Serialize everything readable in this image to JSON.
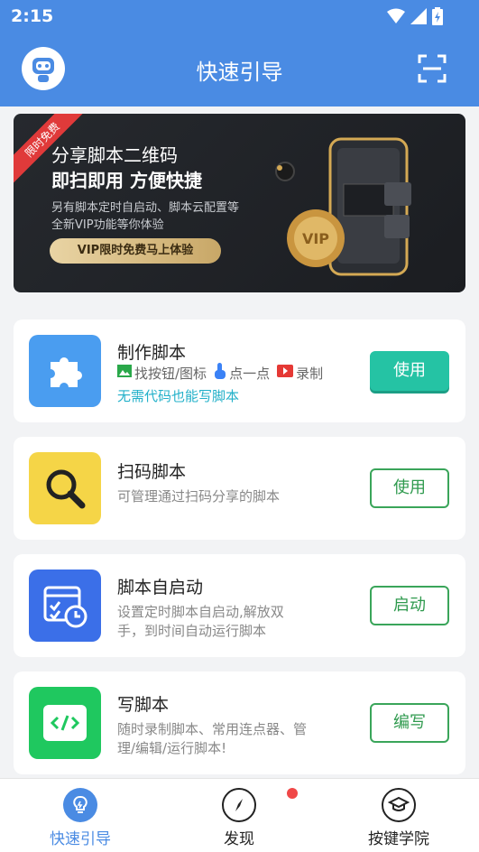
{
  "status_bar": {
    "time": "2:15"
  },
  "header": {
    "title": "快速引导"
  },
  "banner": {
    "ribbon": "限时免费",
    "title_line1": "分享脚本二维码",
    "title_line2": "即扫即用 方便快捷",
    "desc_line1": "另有脚本定时自启动、脚本云配置等",
    "desc_line2": "全新VIP功能等你体验",
    "button": "VIP限时免费马上体验",
    "coin_text": "VIP"
  },
  "cards": [
    {
      "title": "制作脚本",
      "features": [
        "找按钮/图标",
        "点一点",
        "录制"
      ],
      "hint": "无需代码也能写脚本",
      "button": "使用",
      "color": "#4a9df0"
    },
    {
      "title": "扫码脚本",
      "desc": "可管理通过扫码分享的脚本",
      "button": "使用",
      "color": "#f5d547"
    },
    {
      "title": "脚本自启动",
      "desc_line1": "设置定时脚本自启动,解放双",
      "desc_line2": "手，到时间自动运行脚本",
      "button": "启动",
      "color": "#3b6fe8"
    },
    {
      "title": "写脚本",
      "desc_line1": "随时录制脚本、常用连点器、管",
      "desc_line2": "理/编辑/运行脚本!",
      "button": "编写",
      "color": "#1fc85f"
    }
  ],
  "bottom_nav": [
    {
      "label": "快速引导",
      "active": true
    },
    {
      "label": "发现",
      "active": false
    },
    {
      "label": "按键学院",
      "active": false
    }
  ],
  "colors": {
    "primary": "#4a8be3",
    "button_green": "#3aa55a",
    "solid_button": "#25c3a4"
  }
}
